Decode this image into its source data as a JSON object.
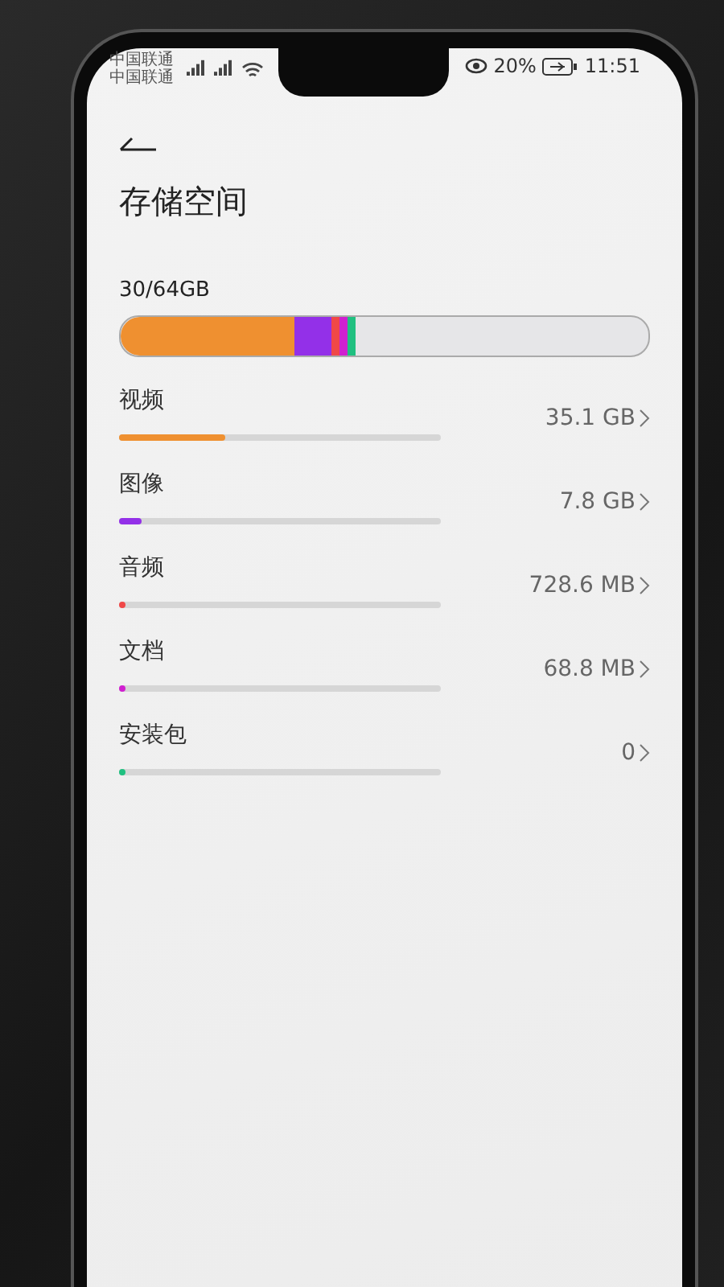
{
  "status_bar": {
    "carriers": [
      "中国联通",
      "中国联通"
    ],
    "battery": "20%",
    "time": "11:51"
  },
  "page": {
    "title": "存储空间",
    "usage": "30/64GB"
  },
  "categories": [
    {
      "name": "视频",
      "size": "35.1 GB",
      "level": 0.33,
      "color": "#ef9030"
    },
    {
      "name": "图像",
      "size": "7.8 GB",
      "level": 0.07,
      "color": "#9330e8"
    },
    {
      "name": "音频",
      "size": "728.6 MB",
      "level": 0.015,
      "color": "#f04848"
    },
    {
      "name": "文档",
      "size": "68.8 MB",
      "level": 0.015,
      "color": "#d020d0"
    },
    {
      "name": "安装包",
      "size": "0",
      "level": 0.015,
      "color": "#20c080"
    }
  ]
}
